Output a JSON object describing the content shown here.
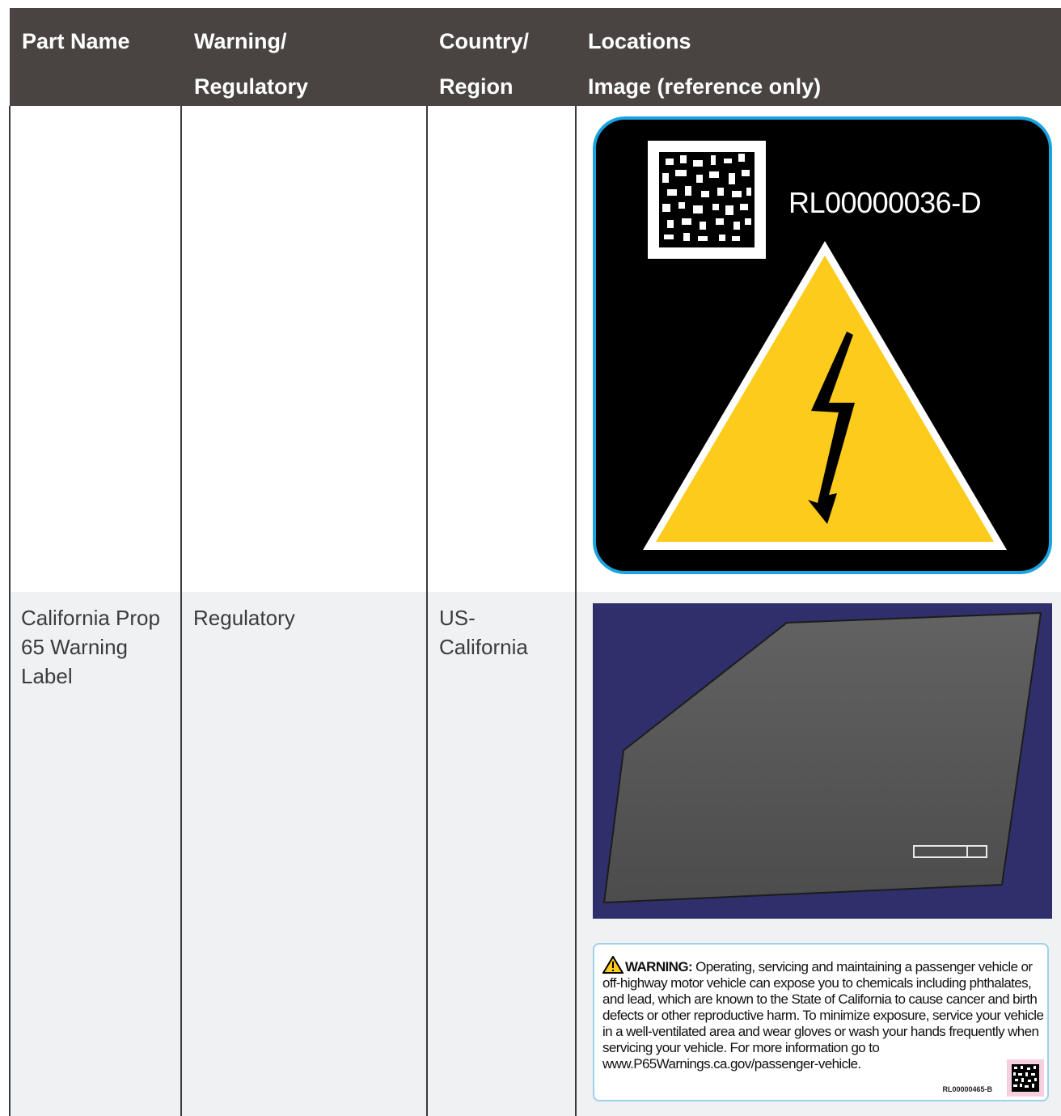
{
  "table": {
    "headers": [
      {
        "line1": "Part Name",
        "line2": ""
      },
      {
        "line1": "Warning/",
        "line2": "Regulatory"
      },
      {
        "line1": "Country/",
        "line2": "Region"
      },
      {
        "line1": "Locations",
        "line2": "Image (reference only)"
      }
    ],
    "rows": [
      {
        "part_name": "",
        "warning_regulatory": "",
        "country_region": "",
        "label_code": "RL00000036-D",
        "icon": "high-voltage-warning-icon"
      },
      {
        "part_name": "California Prop 65 Warning Label",
        "warning_regulatory": "Regulatory",
        "country_region_line1": "US-",
        "country_region_line2": "California",
        "warning_heading": "WARNING:",
        "warning_body": "Operating, servicing and maintaining a passenger vehicle or off-highway motor vehicle can expose you to chemicals including phthalates, and lead, which are known to the State of California to cause cancer and birth defects or other reproductive harm. To minimize exposure, service your vehicle in a well-ventilated area and wear gloves or wash your hands frequently when servicing your vehicle. For more information go to www.P65Warnings.ca.gov/passenger-vehicle.",
        "label_code": "RL00000465-B",
        "icon": "warning-triangle-icon"
      }
    ]
  },
  "colors": {
    "header_bg": "#494442",
    "row_alt_bg": "#f0f1f3",
    "label_border": "#1aa3e0",
    "warning_yellow": "#fdcb1b",
    "door_bg": "#2f2f6b",
    "door_panel": "#5c5c5c"
  }
}
